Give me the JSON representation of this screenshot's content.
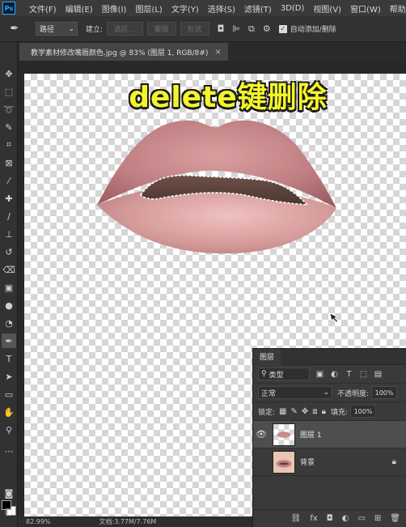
{
  "menu": {
    "app_logo": "Ps",
    "items": [
      "文件(F)",
      "编辑(E)",
      "图像(I)",
      "图层(L)",
      "文字(Y)",
      "选择(S)",
      "滤镜(T)",
      "3D(D)",
      "视图(V)",
      "窗口(W)",
      "帮助"
    ]
  },
  "options": {
    "mode_value": "路径",
    "build_label": "建立:",
    "selection_button": "选区...",
    "mask_button": "蒙版",
    "shape_button": "形状",
    "auto_add_delete_label": "自动添加/删除",
    "auto_add_delete_checked": true
  },
  "document": {
    "tab_title": "教学素材修改嘴唇颜色.jpg @ 83% (图层 1, RGB/8#)",
    "tab_close": "×"
  },
  "canvas": {
    "caption": "delete键删除"
  },
  "status": {
    "zoom": "82.99%",
    "doc_size": "文档:3.77M/7.76M"
  },
  "layers_panel": {
    "tab_label": "图层",
    "kind_filter": "类型",
    "blend_mode": "正常",
    "opacity_label": "不透明度:",
    "opacity_value": "100%",
    "lock_label": "锁定:",
    "fill_label": "填充:",
    "fill_value": "100%",
    "layers": [
      {
        "name": "图层 1",
        "visible": true,
        "selected": true
      },
      {
        "name": "背景",
        "visible": false,
        "selected": false,
        "locked": true
      }
    ]
  },
  "colors": {
    "foreground": "#000000",
    "background": "#ffffff",
    "caption_fill": "#f3f52b"
  },
  "icons": {
    "tools": [
      "move-icon",
      "marquee-icon",
      "lasso-icon",
      "quick-select-icon",
      "crop-icon",
      "frame-icon",
      "eyedropper-icon",
      "healing-icon",
      "brush-icon",
      "stamp-icon",
      "history-brush-icon",
      "eraser-icon",
      "gradient-icon",
      "blur-icon",
      "dodge-icon",
      "pen-icon",
      "type-icon",
      "path-select-icon",
      "rectangle-icon",
      "hand-icon",
      "zoom-icon",
      "more-tools-icon"
    ]
  }
}
